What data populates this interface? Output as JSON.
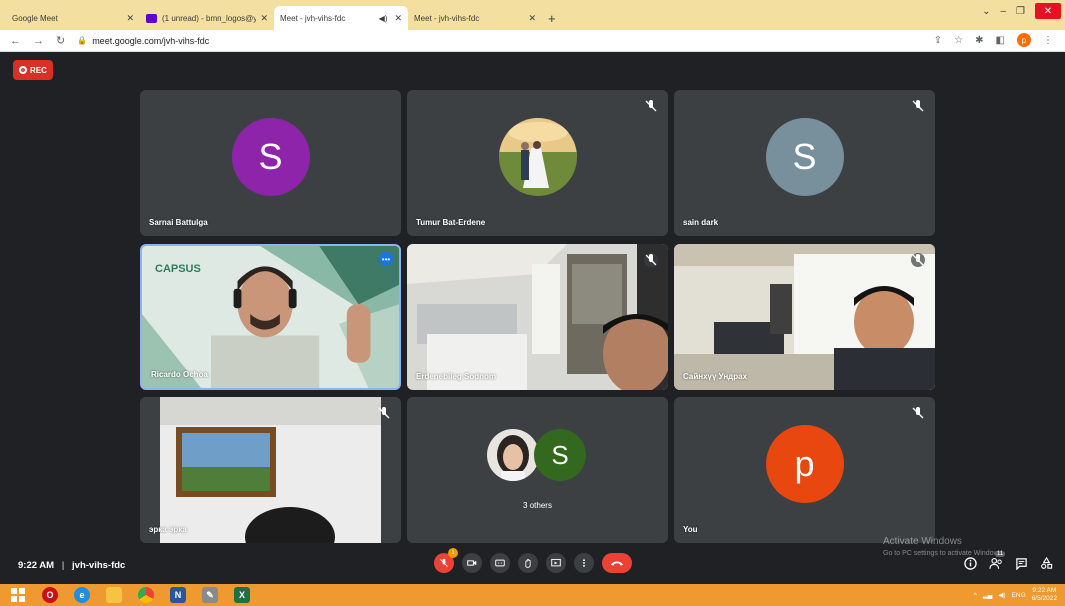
{
  "browser": {
    "tabs": [
      {
        "label": "Google Meet",
        "type": "meet",
        "active": false
      },
      {
        "label": "(1 unread) - bmn_logos@yahoo...",
        "type": "mail",
        "active": false
      },
      {
        "label": "Meet - jvh-vihs-fdc",
        "type": "meet",
        "active": true
      },
      {
        "label": "Meet - jvh-vihs-fdc",
        "type": "meet",
        "active": false
      }
    ],
    "url": "meet.google.com/jvh-vihs-fdc",
    "profile_initial": "p"
  },
  "meet": {
    "rec_label": "REC",
    "tiles": [
      {
        "name": "Sarnai Battulga",
        "kind": "avatar",
        "initial": "S",
        "color": "#8e24aa",
        "muted": false
      },
      {
        "name": "Tumur Bat-Erdene",
        "kind": "photo",
        "muted": true
      },
      {
        "name": "sain dark",
        "kind": "avatar",
        "initial": "S",
        "color": "#78909c",
        "muted": true
      },
      {
        "name": "Ricardo Ochoa",
        "kind": "video",
        "muted": false,
        "logo": "CAPSUS"
      },
      {
        "name": "Erdenebileg Sodnom",
        "kind": "video",
        "muted": true
      },
      {
        "name": "Сайнхүү Ундрах",
        "kind": "video",
        "muted": true
      },
      {
        "name": "эрка эрка",
        "kind": "video",
        "muted": true
      },
      {
        "name": "3 others",
        "kind": "group",
        "initial": "S",
        "color": "#33691e",
        "muted": false
      },
      {
        "name": "You",
        "kind": "avatar",
        "initial": "p",
        "color": "#e8470f",
        "muted": true
      }
    ],
    "clock": "9:22 AM",
    "separator": "|",
    "meeting_code": "jvh-vihs-fdc",
    "raise_badge": "1",
    "participants_count": "11"
  },
  "windows": {
    "watermark_title": "Activate Windows",
    "watermark_sub": "Go to PC settings to activate Windows.",
    "time": "9:22 AM",
    "date": "6/5/2022",
    "lang": "ENG"
  }
}
